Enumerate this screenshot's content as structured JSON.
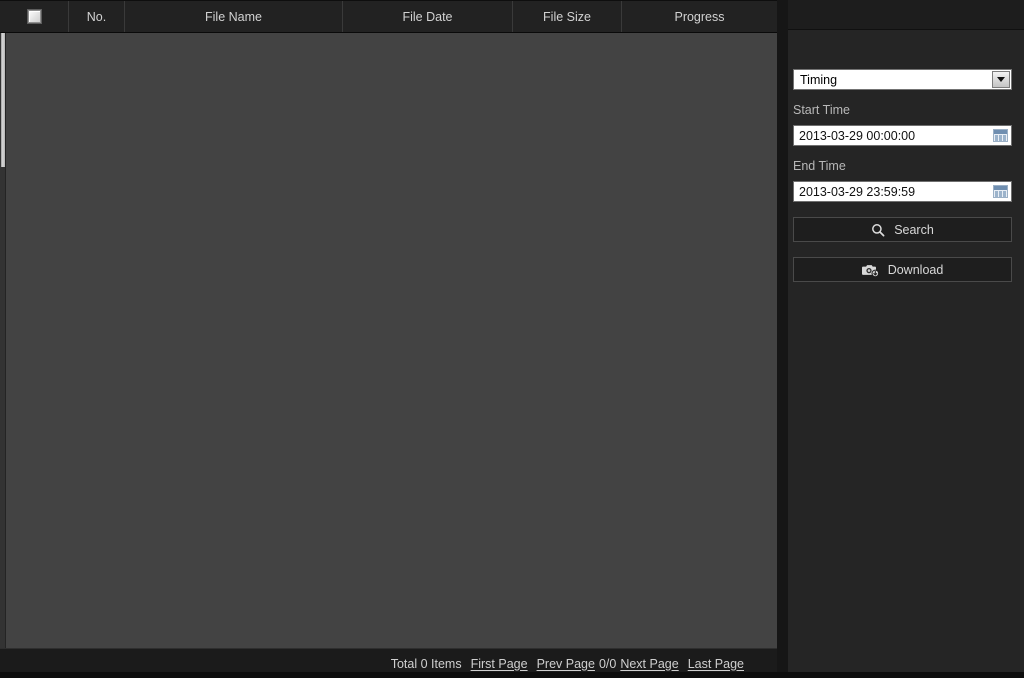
{
  "file_table": {
    "columns": [
      {
        "id": "select",
        "label": ""
      },
      {
        "id": "no",
        "label": "No."
      },
      {
        "id": "filename",
        "label": "File Name"
      },
      {
        "id": "filedate",
        "label": "File Date"
      },
      {
        "id": "filesize",
        "label": "File Size"
      },
      {
        "id": "progress",
        "label": "Progress"
      }
    ],
    "rows": [],
    "select_all_checked": false
  },
  "status_bar": {
    "total_text": "Total 0 Items",
    "first_page": "First Page",
    "prev_page": "Prev Page",
    "page_count": "0/0",
    "next_page": "Next Page",
    "last_page": "Last Page"
  },
  "sidebar": {
    "file_type": {
      "selected": "Timing",
      "options": [
        "Timing"
      ]
    },
    "start_time": {
      "label": "Start Time",
      "value": "2013-03-29 00:00:00"
    },
    "end_time": {
      "label": "End Time",
      "value": "2013-03-29 23:59:59"
    },
    "search_button": "Search",
    "download_button": "Download"
  },
  "colors": {
    "list_background": "#434343",
    "sidebar_background": "#252525",
    "header_background": "#222222",
    "text_primary": "#d2d2d2",
    "text_muted": "#b8b8b8",
    "input_background": "#ffffff"
  }
}
